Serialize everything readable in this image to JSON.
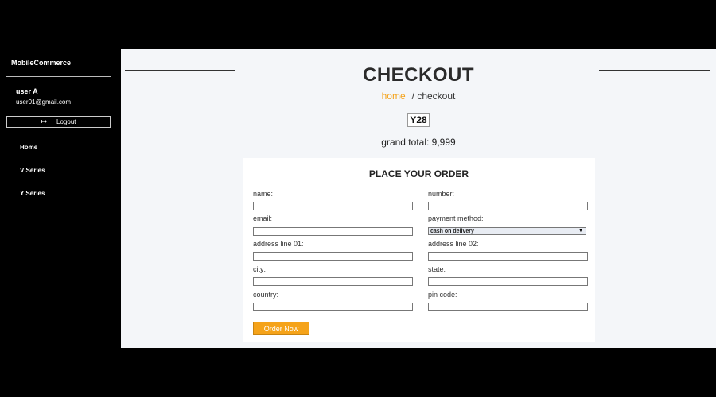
{
  "sidebar": {
    "brand": "MobileCommerce",
    "user_name": "user A",
    "user_email": "user01@gmail.com",
    "logout_label": "Logout",
    "nav": [
      {
        "label": "Home"
      },
      {
        "label": "V Series"
      },
      {
        "label": "Y Series"
      }
    ]
  },
  "main": {
    "title": "CHECKOUT",
    "breadcrumb_home": "home",
    "breadcrumb_current": "/ checkout",
    "product": "Y28",
    "grand_total_label": "grand total:",
    "grand_total_value": "9,999"
  },
  "form": {
    "title": "PLACE YOUR ORDER",
    "fields": {
      "name": {
        "label": "name:",
        "value": ""
      },
      "number": {
        "label": "number:",
        "value": ""
      },
      "email": {
        "label": "email:",
        "value": ""
      },
      "payment_method": {
        "label": "payment method:",
        "value": "cash on delivery"
      },
      "address1": {
        "label": "address line 01:",
        "value": ""
      },
      "address2": {
        "label": "address line 02:",
        "value": ""
      },
      "city": {
        "label": "city:",
        "value": ""
      },
      "state": {
        "label": "state:",
        "value": ""
      },
      "country": {
        "label": "country:",
        "value": ""
      },
      "pincode": {
        "label": "pin code:",
        "value": ""
      }
    },
    "submit_label": "Order Now"
  },
  "colors": {
    "accent": "#f5a31a",
    "sidebar_bg": "#000000",
    "main_bg": "#f4f6f9"
  },
  "icons": {
    "logout": "logout-icon",
    "select": "chevron-down-icon"
  }
}
